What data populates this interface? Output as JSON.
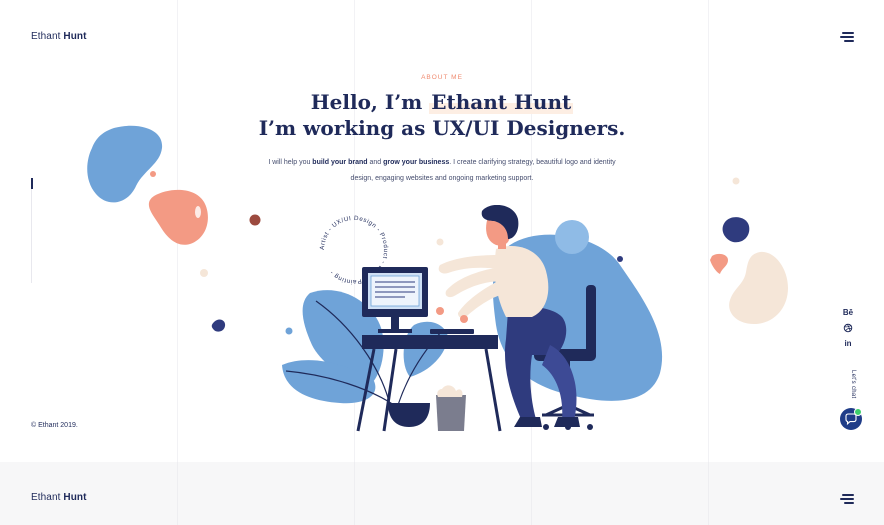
{
  "header": {
    "logo_first": "Ethant",
    "logo_last": "Hunt"
  },
  "hero": {
    "eyebrow": "ABOUT ME",
    "headline_line1_prefix": "Hello, I’m ",
    "headline_line1_name": "Ethant Hunt",
    "headline_line2": "I’m working as UX/UI Designers.",
    "intro_part1": "I will help you ",
    "intro_bold1": "build your brand",
    "intro_part2": " and ",
    "intro_bold2": "grow your business",
    "intro_part3": ". I create clarifying strategy, beautiful logo and identity design, engaging websites and ongoing marketing support.",
    "ring_text": "Artist - UX/UI Design - Product - Digital Painting - "
  },
  "sidebar": {
    "copyright": "© Ethant 2019."
  },
  "social": {
    "behance": "Bē",
    "linkedin": "in",
    "lets_chat": "Let's chat"
  },
  "icons": {
    "menu": "hamburger-menu-icon",
    "dribbble": "dribbble-icon",
    "chat": "chat-bubble-icon"
  },
  "colors": {
    "navy": "#1f2a5a",
    "accent_orange": "#ef8a6f",
    "blob_blue": "#6fa3d8",
    "blob_peach": "#f5e6d8",
    "chat_green": "#3ccf6b"
  },
  "footer": {
    "logo_first": "Ethant",
    "logo_last": "Hunt"
  }
}
